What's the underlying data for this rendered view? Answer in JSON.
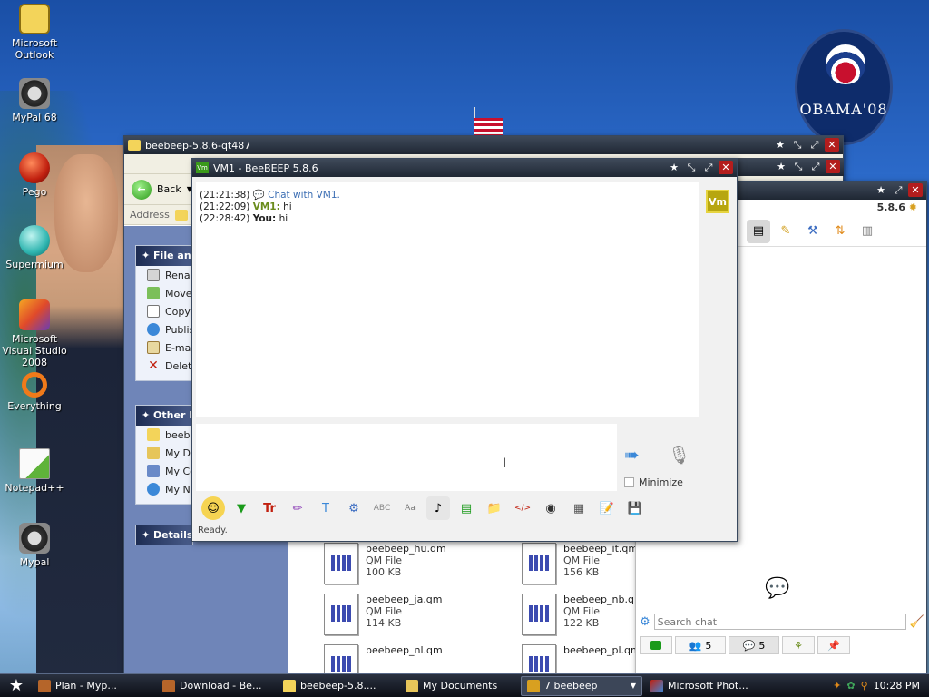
{
  "desktop": {
    "icons": [
      {
        "label": "Microsoft Outlook"
      },
      {
        "label": "MyPal 68"
      },
      {
        "label": "Pego"
      },
      {
        "label": "Supermium"
      },
      {
        "label": "Microsoft Visual Studio 2008"
      },
      {
        "label": "Everything"
      },
      {
        "label": "Notepad++"
      },
      {
        "label": "Mypal"
      }
    ],
    "wallpaper_text": "OBAMA'08"
  },
  "explorer": {
    "title": "beebeep-5.8.6-qt487",
    "back_label": "Back",
    "address_label": "Address",
    "file_folder_tasks": {
      "header": "File and F",
      "items": [
        "Renam",
        "Move",
        "Copy",
        "Publis",
        "E-mail",
        "Delete"
      ]
    },
    "other_places": {
      "header": "Other Pla",
      "items": [
        "beebe",
        "My Do",
        "My Co",
        "My Ne"
      ]
    },
    "details": {
      "header": "Details"
    },
    "files": [
      {
        "name": "beebeep_hu.qm",
        "type": "QM File",
        "size": "100 KB"
      },
      {
        "name": "beebeep_it.qm",
        "type": "QM File",
        "size": "156 KB"
      },
      {
        "name": "beebeep_ja.qm",
        "type": "QM File",
        "size": "114 KB"
      },
      {
        "name": "beebeep_nb.qm",
        "type": "QM File",
        "size": "122 KB"
      },
      {
        "name": "beebeep_nl.qm",
        "type": "",
        "size": ""
      },
      {
        "name": "beebeep_pl.qm",
        "type": "",
        "size": ""
      }
    ]
  },
  "beebeep_main": {
    "version": "5.8.6",
    "search_placeholder": "Search chat",
    "tabs": [
      {
        "icon": "green-square-icon",
        "count": ""
      },
      {
        "icon": "users-icon",
        "count": "5"
      },
      {
        "icon": "chat-bubbles-icon",
        "count": "5"
      },
      {
        "icon": "groups-icon",
        "count": ""
      },
      {
        "icon": "pin-icon",
        "count": ""
      }
    ]
  },
  "chat": {
    "title": "VM1 - BeeBEEP 5.8.6",
    "avatar": "Vm",
    "messages": [
      {
        "time": "(21:21:38)",
        "sender": "",
        "text": "Chat with VM1."
      },
      {
        "time": "(21:22:09)",
        "sender": "VM1:",
        "text": "hi"
      },
      {
        "time": "(22:28:42)",
        "sender": "You:",
        "text": "hi"
      }
    ],
    "minimize_label": "Minimize",
    "status": "Ready.",
    "colors": {
      "sender_vm1": "#6a8c1c",
      "system": "#3a6db3"
    }
  },
  "taskbar": {
    "items": [
      {
        "label": "Plan - Myp..."
      },
      {
        "label": "Download - Be..."
      },
      {
        "label": "beebeep-5.8...."
      },
      {
        "label": "My Documents"
      },
      {
        "label": "7 beebeep"
      },
      {
        "label": "Microsoft Phot..."
      }
    ],
    "clock": "10:28 PM"
  }
}
